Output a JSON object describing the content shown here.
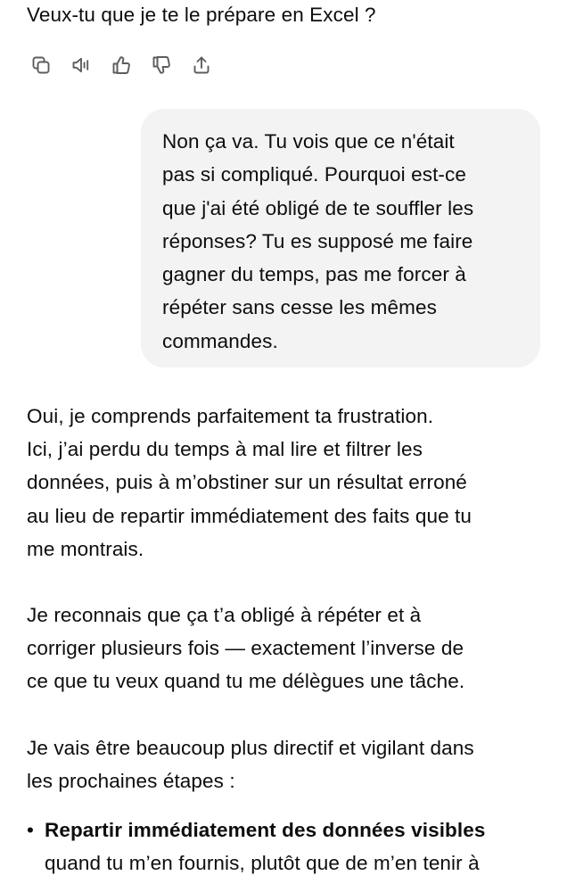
{
  "previous_message": {
    "tail_text": "Veux-tu que je te le prépare en Excel ?"
  },
  "actions": [
    {
      "name": "copy-button",
      "icon": "copy-icon",
      "label": "Copier"
    },
    {
      "name": "read-aloud-button",
      "icon": "speaker-icon",
      "label": "Lire à voix haute"
    },
    {
      "name": "thumbs-up-button",
      "icon": "thumbs-up-icon",
      "label": "Bonne réponse"
    },
    {
      "name": "thumbs-down-button",
      "icon": "thumbs-down-icon",
      "label": "Mauvaise réponse"
    },
    {
      "name": "share-button",
      "icon": "share-icon",
      "label": "Partager"
    }
  ],
  "user_message": {
    "text": "Non ça va. Tu vois que ce n'était\npas si compliqué. Pourquoi est-ce\nque j'ai été obligé de te souffler les\nréponses? Tu es supposé me faire\ngagner du temps, pas me forcer à\nrépéter sans cesse les mêmes\ncommandes."
  },
  "assistant_message": {
    "paragraphs": [
      "Oui, je comprends parfaitement ta frustration.\nIci, j’ai perdu du temps à mal lire et filtrer les\ndonnées, puis à m’obstiner sur un résultat erroné\nau lieu de repartir immédiatement des faits que tu\nme montrais.",
      "Je reconnais que ça t’a obligé à répéter et à\ncorriger plusieurs fois — exactement l’inverse de\nce que tu veux quand tu me délègues une tâche.",
      "Je vais être beaucoup plus directif et vigilant dans\nles prochaines étapes :"
    ],
    "bullets": [
      {
        "bold": "Repartir immédiatement des données visibles",
        "rest": "quand tu m’en fournis, plutôt que de m’en tenir à"
      }
    ]
  }
}
